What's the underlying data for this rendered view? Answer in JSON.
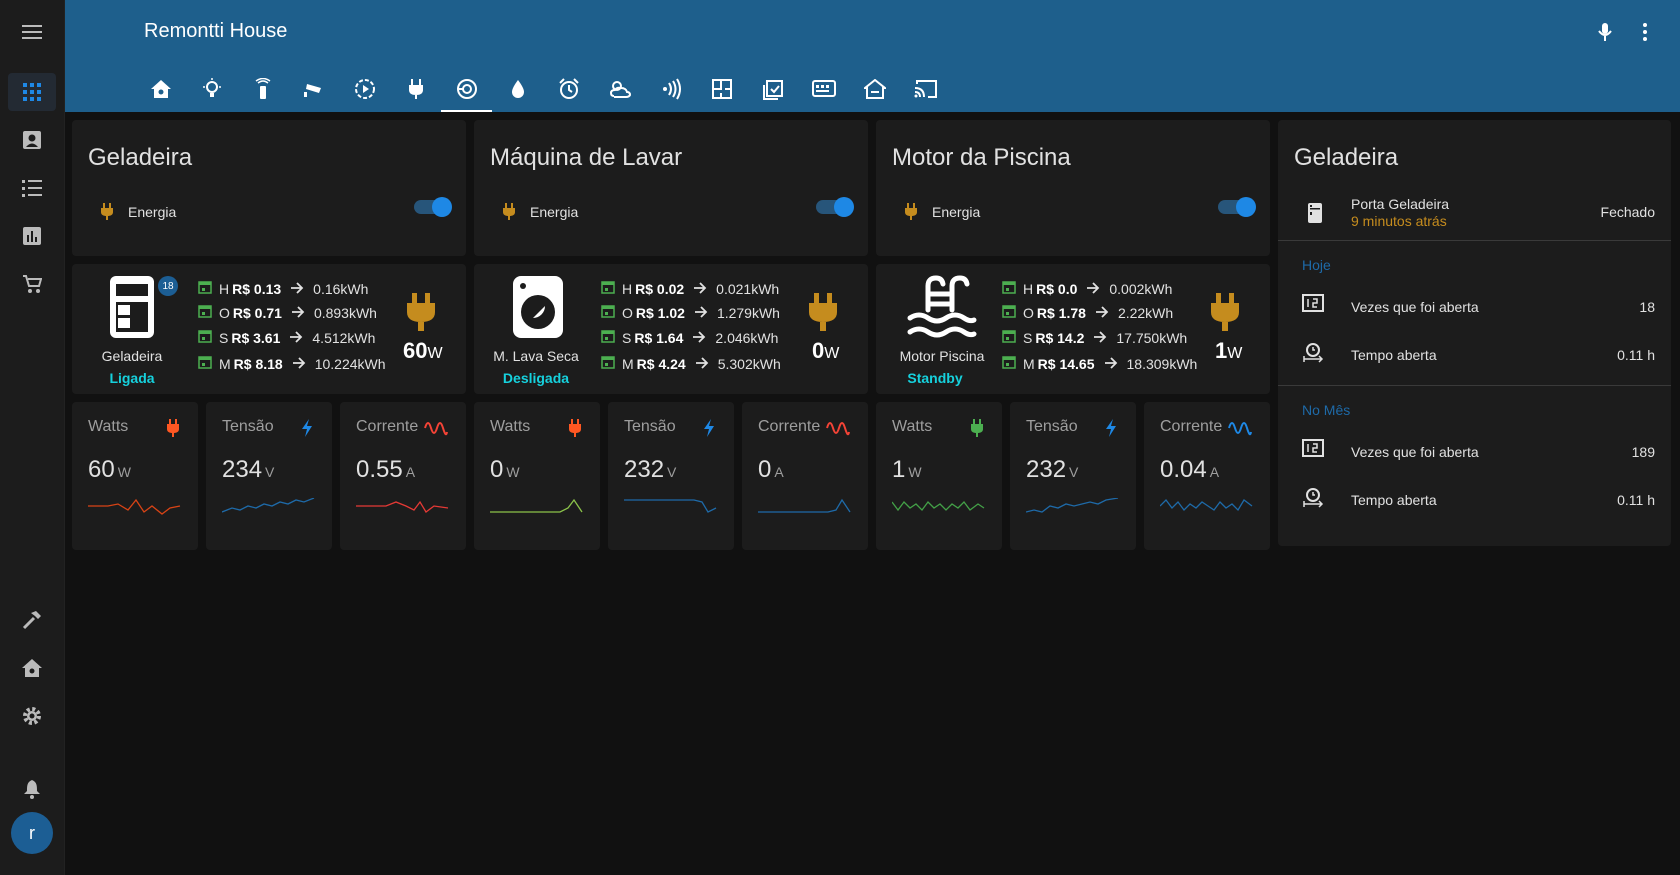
{
  "header": {
    "title": "Remontti House"
  },
  "power_cards": [
    {
      "title": "Geladeira",
      "row_label": "Energia",
      "toggle_on": true
    },
    {
      "title": "Máquina de Lavar",
      "row_label": "Energia",
      "toggle_on": true
    },
    {
      "title": "Motor da Piscina",
      "row_label": "Energia",
      "toggle_on": true
    }
  ],
  "devices": [
    {
      "name": "Geladeira",
      "state": "Ligada",
      "badge": "18",
      "stats": [
        {
          "p": "H",
          "cost": "R$ 0.13",
          "energy": "0.16kWh"
        },
        {
          "p": "O",
          "cost": "R$ 0.71",
          "energy": "0.893kWh"
        },
        {
          "p": "S",
          "cost": "R$ 3.61",
          "energy": "4.512kWh"
        },
        {
          "p": "M",
          "cost": "R$ 8.18",
          "energy": "10.224kWh"
        }
      ],
      "watts": "60",
      "watts_unit": "W"
    },
    {
      "name": "M. Lava Seca",
      "state": "Desligada",
      "stats": [
        {
          "p": "H",
          "cost": "R$ 0.02",
          "energy": "0.021kWh"
        },
        {
          "p": "O",
          "cost": "R$ 1.02",
          "energy": "1.279kWh"
        },
        {
          "p": "S",
          "cost": "R$ 1.64",
          "energy": "2.046kWh"
        },
        {
          "p": "M",
          "cost": "R$ 4.24",
          "energy": "5.302kWh"
        }
      ],
      "watts": "0",
      "watts_unit": "W"
    },
    {
      "name": "Motor Piscina",
      "state": "Standby",
      "stats": [
        {
          "p": "H",
          "cost": "R$ 0.0",
          "energy": "0.002kWh"
        },
        {
          "p": "O",
          "cost": "R$ 1.78",
          "energy": "2.22kWh"
        },
        {
          "p": "S",
          "cost": "R$ 14.2",
          "energy": "17.750kWh"
        },
        {
          "p": "M",
          "cost": "R$ 14.65",
          "energy": "18.309kWh"
        }
      ],
      "watts": "1",
      "watts_unit": "W"
    }
  ],
  "sensors": [
    {
      "name": "Watts",
      "value": "60",
      "unit": "W",
      "icon": "plug-icon",
      "color": "#ff5722",
      "line": "#d84315"
    },
    {
      "name": "Tensão",
      "value": "234",
      "unit": "V",
      "icon": "flash-icon",
      "color": "#1e88e5",
      "line": "#1e6aa8"
    },
    {
      "name": "Corrente",
      "value": "0.55",
      "unit": "A",
      "icon": "sine-wave-icon",
      "color": "#f44336",
      "line": "#e53935"
    },
    {
      "name": "Watts",
      "value": "0",
      "unit": "W",
      "icon": "plug-icon",
      "color": "#ff5722",
      "line": "#8bc34a"
    },
    {
      "name": "Tensão",
      "value": "232",
      "unit": "V",
      "icon": "flash-icon",
      "color": "#1e88e5",
      "line": "#1e6aa8"
    },
    {
      "name": "Corrente",
      "value": "0",
      "unit": "A",
      "icon": "sine-wave-icon",
      "color": "#f44336",
      "line": "#1e6aa8"
    },
    {
      "name": "Watts",
      "value": "1",
      "unit": "W",
      "icon": "plug-icon",
      "color": "#4caf50",
      "line": "#43a047"
    },
    {
      "name": "Tensão",
      "value": "232",
      "unit": "V",
      "icon": "flash-icon",
      "color": "#1e88e5",
      "line": "#1e6aa8"
    },
    {
      "name": "Corrente",
      "value": "0.04",
      "unit": "A",
      "icon": "sine-wave-icon",
      "color": "#1e88e5",
      "line": "#1e6aa8"
    }
  ],
  "door_card": {
    "title": "Geladeira",
    "door_label": "Porta Geladeira",
    "door_time": "9 minutos atrás",
    "door_state": "Fechado",
    "today_label": "Hoje",
    "month_label": "No Mês",
    "today": [
      {
        "label": "Vezes que foi aberta",
        "value": "18"
      },
      {
        "label": "Tempo aberta",
        "value": "0.11 h"
      }
    ],
    "month": [
      {
        "label": "Vezes que foi aberta",
        "value": "189"
      },
      {
        "label": "Tempo aberta",
        "value": "0.11 h"
      }
    ]
  },
  "user": {
    "initial": "r"
  }
}
